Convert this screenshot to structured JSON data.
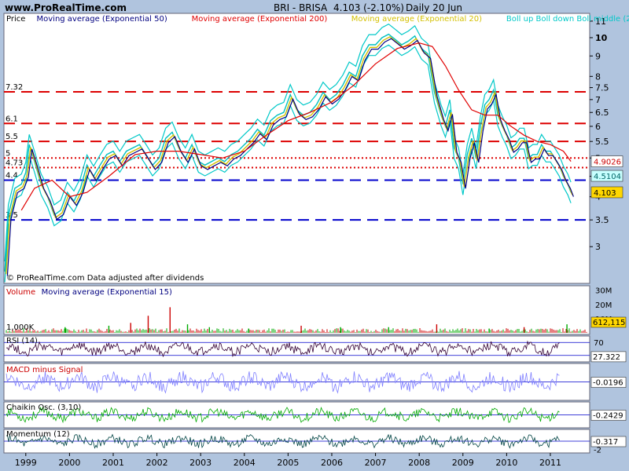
{
  "header": {
    "site": "www.ProRealTime.com",
    "ticker": "BRI - BRISA",
    "price": "4.103 (-2.10%)",
    "period": "Daily  20 Jun"
  },
  "colors": {
    "background": "#b0c4de",
    "panel": "#ffffff",
    "price": "#00c0c0",
    "ema50": "#000080",
    "ema200": "#e00000",
    "ema20": "#d4c000",
    "bollinger": "#00c8c8",
    "level_red": "#dd0000",
    "level_blue": "#0000cc"
  },
  "chart_data": [
    {
      "panel": "price",
      "type": "line",
      "legend": [
        {
          "name": "Price",
          "color": "#000000"
        },
        {
          "name": "Moving average (Exponential 50)",
          "color": "#000080"
        },
        {
          "name": "Moving average (Exponential 200)",
          "color": "#e00000"
        },
        {
          "name": "Moving average (Exponential 20)",
          "color": "#d4c000"
        },
        {
          "name": "Boll up Boll down Boll middle (20 2)",
          "color": "#00c8c8"
        }
      ],
      "y_scale": "log",
      "ylim": [
        2.45,
        11.4
      ],
      "yticks": [
        "11",
        "10",
        "9",
        "8",
        "7.5",
        "7",
        "6.5",
        "6",
        "5.5",
        "5",
        "4.5",
        "4",
        "3.5",
        "3"
      ],
      "xticks": [
        "1999",
        "2000",
        "2001",
        "2002",
        "2003",
        "2004",
        "2005",
        "2006",
        "2007",
        "2008",
        "2009",
        "2010",
        "2011"
      ],
      "xlim": [
        1998.5,
        2011.9
      ],
      "levels": [
        {
          "label": "7.32",
          "value": 7.32,
          "color": "#dd0000",
          "style": "dashed"
        },
        {
          "label": "6.1",
          "value": 6.1,
          "color": "#dd0000",
          "style": "dashed"
        },
        {
          "label": "5.5",
          "value": 5.5,
          "color": "#dd0000",
          "style": "dashed"
        },
        {
          "label": "5",
          "value": 5.0,
          "color": "#dd0000",
          "style": "dotted"
        },
        {
          "label": "4.73",
          "value": 4.73,
          "color": "#dd0000",
          "style": "dotted"
        },
        {
          "label": "4.4",
          "value": 4.4,
          "color": "#0000cc",
          "style": "dashed"
        },
        {
          "label": "3.5",
          "value": 3.5,
          "color": "#0000cc",
          "style": "dashed"
        }
      ],
      "value_tags": [
        {
          "label": "4.9026",
          "value": 4.9026,
          "bg": "#ffffff",
          "fg": "#cc0000"
        },
        {
          "label": "4.5104",
          "value": 4.5104,
          "bg": "#c8ffff",
          "fg": "#006666"
        },
        {
          "label": "4.103",
          "value": 4.103,
          "bg": "#ffd700",
          "fg": "#000000"
        }
      ],
      "series": [
        {
          "role": "price",
          "x": [
            1998.52,
            1998.6,
            1998.75,
            1998.9,
            1999.0,
            1999.08,
            1999.2,
            1999.35,
            1999.5,
            1999.65,
            1999.8,
            1999.95,
            2000.1,
            2000.25,
            2000.4,
            2000.55,
            2000.7,
            2000.85,
            2001.0,
            2001.15,
            2001.3,
            2001.45,
            2001.6,
            2001.75,
            2001.9,
            2002.05,
            2002.2,
            2002.35,
            2002.5,
            2002.65,
            2002.8,
            2002.95,
            2003.1,
            2003.25,
            2003.4,
            2003.55,
            2003.7,
            2003.85,
            2004.0,
            2004.15,
            2004.3,
            2004.45,
            2004.6,
            2004.75,
            2004.9,
            2005.05,
            2005.2,
            2005.35,
            2005.5,
            2005.65,
            2005.8,
            2005.95,
            2006.1,
            2006.25,
            2006.4,
            2006.55,
            2006.7,
            2006.85,
            2007.0,
            2007.15,
            2007.3,
            2007.45,
            2007.6,
            2007.75,
            2007.9,
            2008.05,
            2008.2,
            2008.35,
            2008.5,
            2008.6,
            2008.7,
            2008.8,
            2008.9,
            2009.0,
            2009.1,
            2009.2,
            2009.3,
            2009.4,
            2009.5,
            2009.6,
            2009.7,
            2009.8,
            2009.9,
            2010.0,
            2010.1,
            2010.2,
            2010.3,
            2010.4,
            2010.5,
            2010.6,
            2010.7,
            2010.8,
            2010.9,
            2011.0,
            2011.1,
            2011.2,
            2011.3,
            2011.4,
            2011.47
          ],
          "values": [
            2.6,
            3.6,
            4.2,
            4.3,
            4.6,
            5.4,
            4.9,
            4.3,
            4.0,
            3.6,
            3.7,
            4.1,
            3.9,
            4.2,
            4.8,
            4.5,
            4.8,
            5.1,
            5.2,
            4.9,
            5.2,
            5.3,
            5.4,
            5.1,
            4.8,
            5.0,
            5.6,
            5.8,
            5.3,
            5.0,
            5.4,
            4.9,
            4.8,
            4.9,
            5.0,
            4.9,
            5.1,
            5.2,
            5.4,
            5.6,
            5.9,
            5.7,
            6.2,
            6.4,
            6.5,
            7.2,
            6.6,
            6.4,
            6.5,
            6.8,
            7.3,
            7.0,
            7.2,
            7.6,
            8.2,
            8.0,
            9.0,
            9.6,
            9.6,
            10.0,
            10.2,
            9.9,
            9.6,
            9.8,
            10.1,
            9.4,
            9.1,
            7.3,
            6.4,
            6.0,
            6.6,
            5.3,
            5.0,
            4.3,
            5.1,
            5.6,
            5.0,
            6.0,
            6.8,
            7.0,
            7.4,
            6.4,
            6.0,
            5.7,
            5.3,
            5.4,
            5.6,
            5.6,
            5.0,
            5.1,
            5.1,
            5.4,
            5.2,
            5.2,
            5.0,
            4.8,
            4.5,
            4.3,
            4.103
          ]
        },
        {
          "role": "ema200",
          "x": [
            1998.9,
            1999.2,
            1999.6,
            2000.0,
            2000.4,
            2000.9,
            2001.5,
            2002.0,
            2002.5,
            2003.0,
            2003.5,
            2004.0,
            2004.5,
            2005.0,
            2005.5,
            2006.0,
            2006.5,
            2007.0,
            2007.5,
            2008.0,
            2008.3,
            2008.6,
            2008.9,
            2009.2,
            2009.5,
            2009.8,
            2010.1,
            2010.4,
            2010.7,
            2011.0,
            2011.3,
            2011.47
          ],
          "values": [
            3.7,
            4.2,
            4.4,
            4.0,
            4.1,
            4.5,
            5.1,
            5.2,
            5.2,
            5.1,
            5.0,
            5.2,
            5.7,
            6.2,
            6.5,
            6.9,
            7.6,
            8.6,
            9.4,
            9.7,
            9.5,
            8.5,
            7.4,
            6.6,
            6.4,
            6.4,
            6.0,
            5.7,
            5.5,
            5.4,
            5.2,
            4.9026
          ]
        }
      ]
    },
    {
      "panel": "volume",
      "type": "bar",
      "legend": [
        {
          "name": "Volume",
          "color": "#cc0000"
        },
        {
          "name": "Moving average (Exponential 15)",
          "color": "#000080"
        }
      ],
      "yticks": [
        "30M",
        "20M",
        "10M"
      ],
      "ylim": [
        0,
        32
      ],
      "inner_label": "1,000K",
      "value_tag": "612,115",
      "spikes": {
        "x": [
          1999.9,
          2000.9,
          2001.4,
          2001.8,
          2002.3,
          2002.7,
          2003.2,
          2004.1,
          2005.3,
          2006.2,
          2007.3,
          2008.4,
          2009.6,
          2010.4,
          2011.38
        ],
        "values": [
          4,
          5,
          7,
          12,
          18,
          6,
          4,
          3,
          5,
          4,
          4,
          6,
          3,
          4,
          6
        ],
        "colors": [
          "#00aa00",
          "#00aa00",
          "#cc0000",
          "#cc0000",
          "#cc0000",
          "#00aa00",
          "#00aa00",
          "#00aa00",
          "#cc0000",
          "#00aa00",
          "#00aa00",
          "#cc0000",
          "#00aa00",
          "#cc0000",
          "#00aa00"
        ]
      }
    },
    {
      "panel": "rsi",
      "type": "line",
      "legend": [
        {
          "name": "RSI (14)",
          "color": "#000000"
        }
      ],
      "yticks": [
        "70"
      ],
      "ylim": [
        15,
        85
      ],
      "hlines": [
        70,
        30
      ],
      "value_tag": "27.322",
      "line_color": "#330033"
    },
    {
      "panel": "macd",
      "type": "line",
      "legend": [
        {
          "name": "MACD minus Signal",
          "color": "#cc0000"
        }
      ],
      "ylim": [
        -0.5,
        0.5
      ],
      "hlines": [
        0
      ],
      "value_tag": "-0.0196",
      "line_color": "#8080ff"
    },
    {
      "panel": "chaikin",
      "type": "line",
      "legend": [
        {
          "name": "Chaikin Osc. (3,10)",
          "color": "#000000"
        }
      ],
      "ylim": [
        -1,
        1
      ],
      "hlines": [
        0
      ],
      "value_tag": "-0.2429",
      "line_color": "#00aa00"
    },
    {
      "panel": "momentum",
      "type": "line",
      "legend": [
        {
          "name": "Momentum (12)",
          "color": "#000000"
        }
      ],
      "yticks": [
        "-2"
      ],
      "ylim": [
        -2.5,
        2.5
      ],
      "hlines": [
        0
      ],
      "value_tag": "-0.317",
      "line_color": "#004444"
    }
  ],
  "footnote": "© ProRealTime.com  Data adjusted after dividends"
}
